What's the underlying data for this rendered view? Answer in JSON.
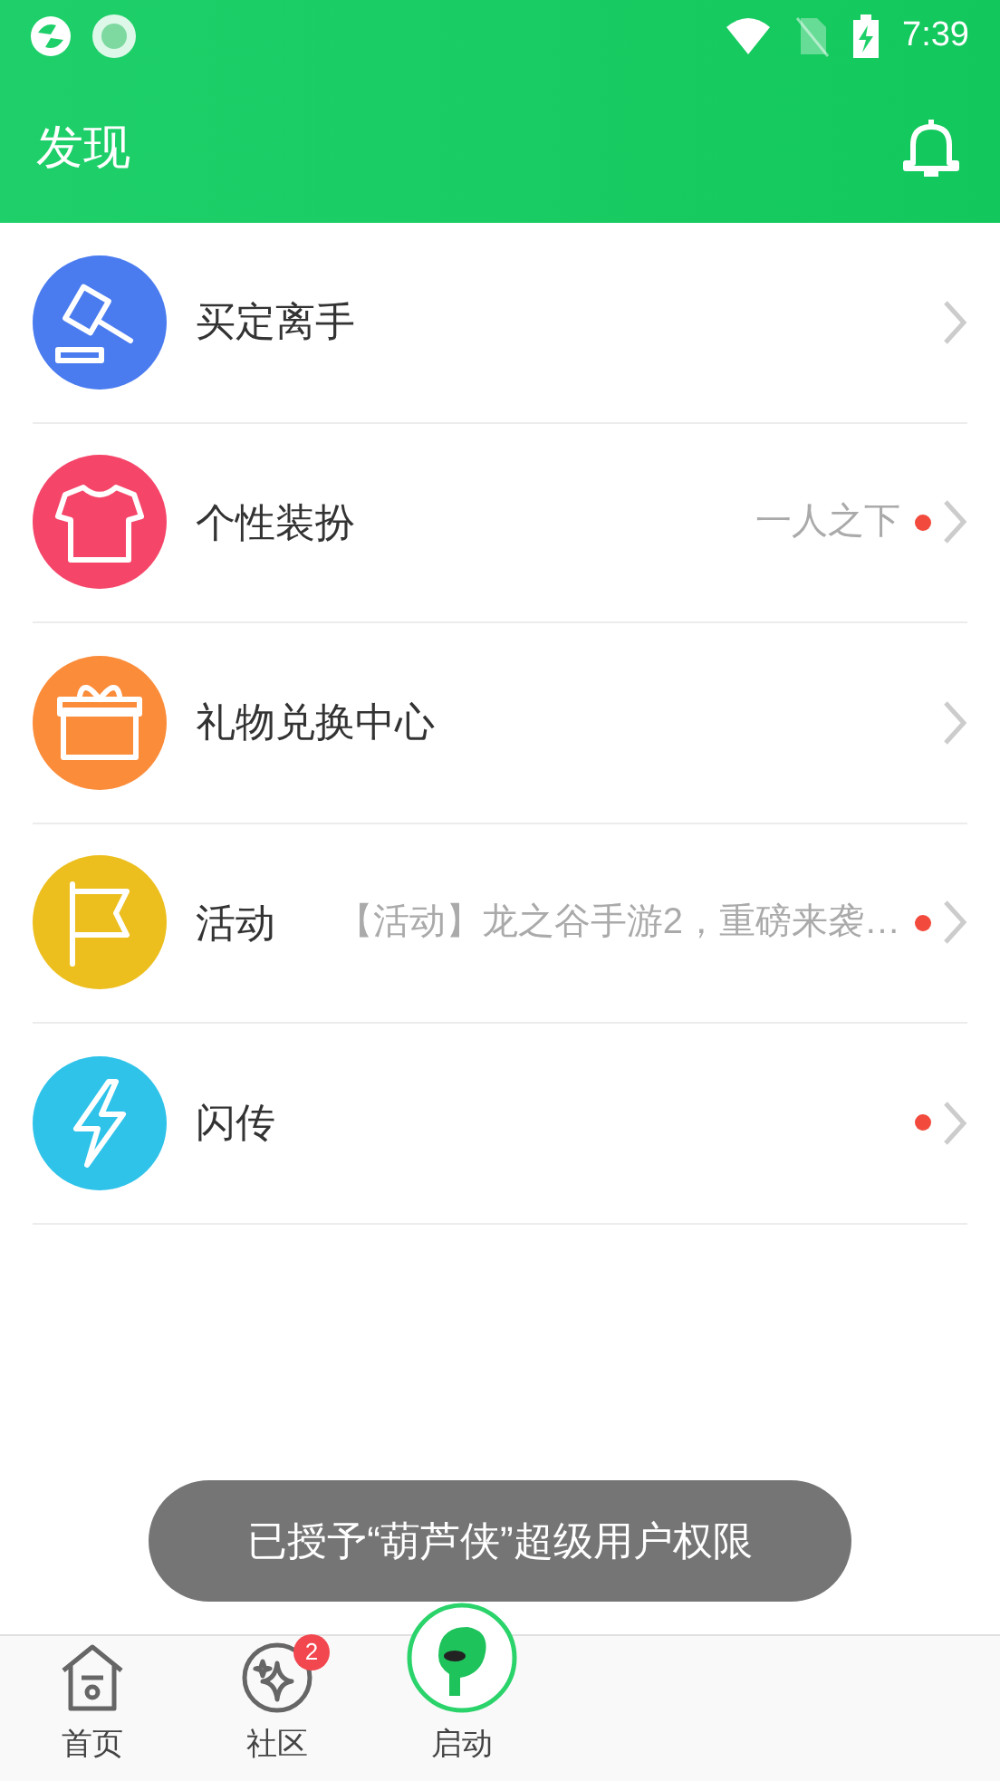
{
  "status_bar": {
    "time": "7:39"
  },
  "header": {
    "title": "发现"
  },
  "items": [
    {
      "kind": "gavel",
      "color": "#4a7cf0",
      "title": "买定离手",
      "new": false
    },
    {
      "kind": "shirt",
      "color": "#f5466a",
      "title": "个性装扮",
      "subtitle": "一人之下",
      "new": true
    },
    {
      "kind": "gift",
      "color": "#fb8c3a",
      "title": "礼物兑换中心",
      "new": false
    },
    {
      "kind": "flag",
      "color": "#ecbf1e",
      "title": "活动",
      "subtitle": "【活动】龙之谷手游2，重磅来袭…",
      "new": true
    },
    {
      "kind": "bolt",
      "color": "#2fc3ea",
      "title": "闪传",
      "new": true
    }
  ],
  "toast": {
    "text": "已授予“葫芦侠”超级用户权限"
  },
  "bottom_nav": [
    {
      "kind": "home",
      "label": "首页"
    },
    {
      "kind": "community",
      "label": "社区",
      "badge": "2"
    },
    {
      "kind": "launch",
      "label": "启动"
    }
  ]
}
